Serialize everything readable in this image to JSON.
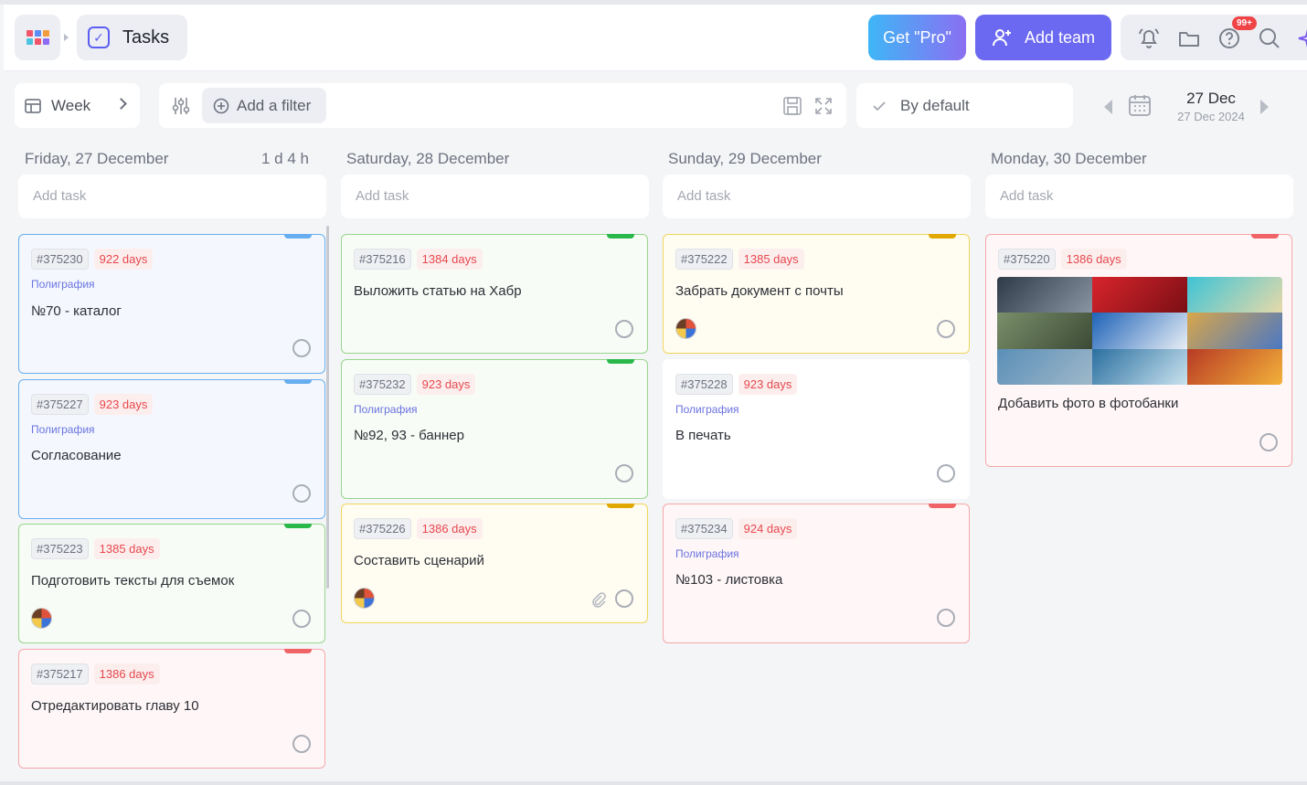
{
  "header": {
    "app_title": "Tasks",
    "pro_label": "Get \"Pro\"",
    "team_label": "Add team",
    "notification_badge": "99+"
  },
  "toolbar": {
    "view_label": "Week",
    "filter_label": "Add a filter",
    "sort_label": "By default",
    "date_main": "27 Dec",
    "date_sub": "27 Dec 2024"
  },
  "add_task_placeholder": "Add task",
  "columns": [
    {
      "day": "Friday, 27 December",
      "duration": "1 d 4 h",
      "cards": [
        {
          "id": "#375230",
          "days": "922 days",
          "tag": "Полиграфия",
          "title": "№70 - каталог",
          "color": "blue"
        },
        {
          "id": "#375227",
          "days": "923 days",
          "tag": "Полиграфия",
          "title": "Согласование",
          "color": "blue"
        },
        {
          "id": "#375223",
          "days": "1385 days",
          "tag": "",
          "title": "Подготовить тексты для съемок",
          "color": "green"
        },
        {
          "id": "#375217",
          "days": "1386 days",
          "tag": "",
          "title": "Отредактировать главу 10",
          "color": "red"
        }
      ]
    },
    {
      "day": "Saturday, 28 December",
      "duration": "",
      "cards": [
        {
          "id": "#375216",
          "days": "1384 days",
          "tag": "",
          "title": "Выложить статью на Хабр",
          "color": "green"
        },
        {
          "id": "#375232",
          "days": "923 days",
          "tag": "Полиграфия",
          "title": "№92, 93 - баннер",
          "color": "green"
        },
        {
          "id": "#375226",
          "days": "1386 days",
          "tag": "",
          "title": "Составить сценарий",
          "color": "yellow"
        }
      ]
    },
    {
      "day": "Sunday, 29 December",
      "duration": "",
      "cards": [
        {
          "id": "#375222",
          "days": "1385 days",
          "tag": "",
          "title": "Забрать документ с почты",
          "color": "yellow"
        },
        {
          "id": "#375228",
          "days": "923 days",
          "tag": "Полиграфия",
          "title": "В печать",
          "color": "white"
        },
        {
          "id": "#375234",
          "days": "924 days",
          "tag": "Полиграфия",
          "title": "№103 - листовка",
          "color": "red"
        }
      ]
    },
    {
      "day": "Monday, 30 December",
      "duration": "",
      "cards": [
        {
          "id": "#375220",
          "days": "1386 days",
          "tag": "",
          "title": "Добавить фото в фотобанки",
          "color": "red"
        }
      ]
    }
  ],
  "colors": {
    "accent": "#6b68f2",
    "overdue_text": "#e5484d",
    "tag_text": "#6a73e0",
    "blue_border": "#66aef0",
    "green_border": "#96d68c",
    "yellow_border": "#f1d55c",
    "red_border": "#f5a7a9"
  },
  "icons": [
    "apps-grid-icon",
    "tasks-check-icon",
    "add-user-icon",
    "bell-icon",
    "folder-icon",
    "help-icon",
    "search-icon",
    "sparkle-icon",
    "calendar-table-icon",
    "filter-sliders-icon",
    "plus-circle-icon",
    "save-icon",
    "expand-icon",
    "check-icon",
    "calendar-icon",
    "attachment-icon"
  ]
}
